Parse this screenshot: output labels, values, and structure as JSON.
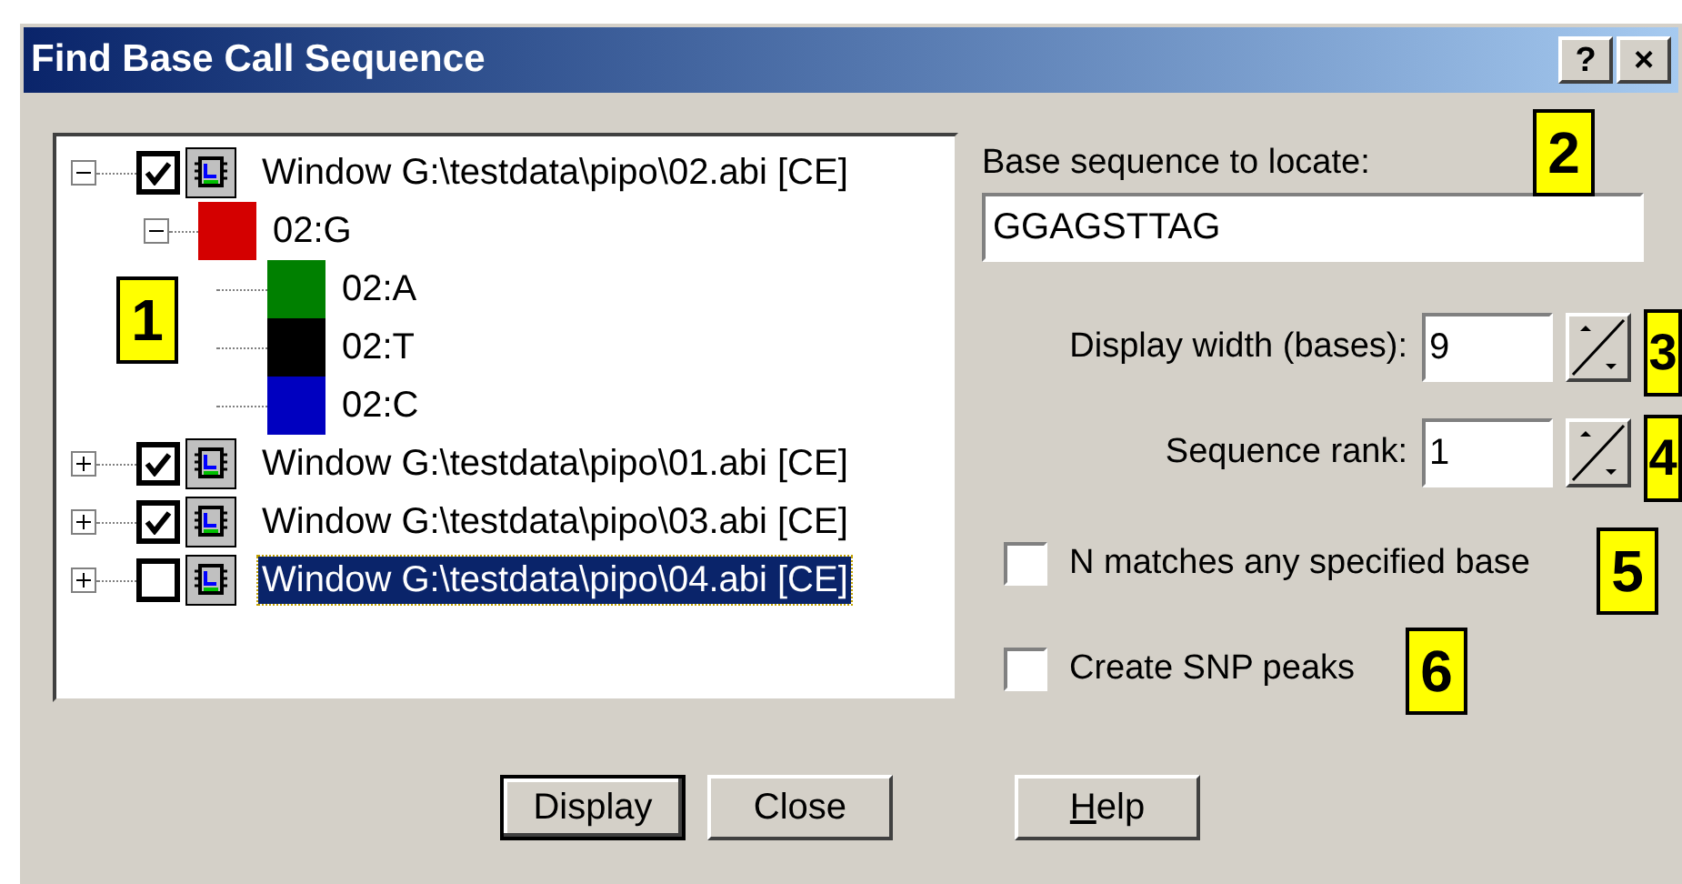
{
  "window": {
    "title": "Find Base Call Sequence",
    "title_buttons": [
      "?",
      "×"
    ]
  },
  "tree": [
    {
      "kind": "window",
      "label": "Window G:\\testdata\\pipo\\02.abi [CE]",
      "expanded": true,
      "checked": true,
      "selected": false,
      "children": [
        {
          "kind": "channel",
          "label": "02:G",
          "color": "#d40000",
          "expanded": true,
          "children": [
            {
              "kind": "channel",
              "label": "02:A",
              "color": "#008000"
            },
            {
              "kind": "channel",
              "label": "02:T",
              "color": "#000000"
            },
            {
              "kind": "channel",
              "label": "02:C",
              "color": "#0000c0"
            }
          ]
        }
      ]
    },
    {
      "kind": "window",
      "label": "Window G:\\testdata\\pipo\\01.abi [CE]",
      "expanded": false,
      "checked": true,
      "selected": false
    },
    {
      "kind": "window",
      "label": "Window G:\\testdata\\pipo\\03.abi [CE]",
      "expanded": false,
      "checked": true,
      "selected": false
    },
    {
      "kind": "window",
      "label": "Window G:\\testdata\\pipo\\04.abi [CE]",
      "expanded": false,
      "checked": false,
      "selected": true
    }
  ],
  "sequence": {
    "label": "Base sequence to locate:",
    "value": "GGAGSTTAG"
  },
  "spinners": [
    {
      "label": "Display width (bases):",
      "value": "9"
    },
    {
      "label": "Sequence rank:",
      "value": "1"
    }
  ],
  "options": [
    {
      "label": "N matches any specified base",
      "checked": false
    },
    {
      "label": "Create SNP peaks",
      "checked": false
    }
  ],
  "buttons": [
    {
      "label": "Display",
      "default": true
    },
    {
      "label": "Close",
      "default": false
    },
    {
      "label": "Help",
      "default": false,
      "underline_first_letter": true
    }
  ],
  "callouts": [
    "1",
    "2",
    "3",
    "4",
    "5",
    "6"
  ]
}
